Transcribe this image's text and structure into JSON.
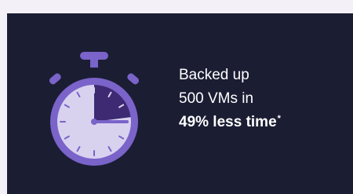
{
  "stat": {
    "line1": "Backed up",
    "line2": "500 VMs in",
    "highlight": "49% less time",
    "footnote_mark": "*"
  },
  "stopwatch": {
    "icon": "stopwatch-icon",
    "elapsed_fraction": 0.23
  },
  "colors": {
    "background": "#1b1d33",
    "page": "#f3f0f8",
    "ring": "#7a63c9",
    "face": "#d9d2ef",
    "elapsed_wedge": "#3d2a73",
    "text": "#ffffff"
  }
}
